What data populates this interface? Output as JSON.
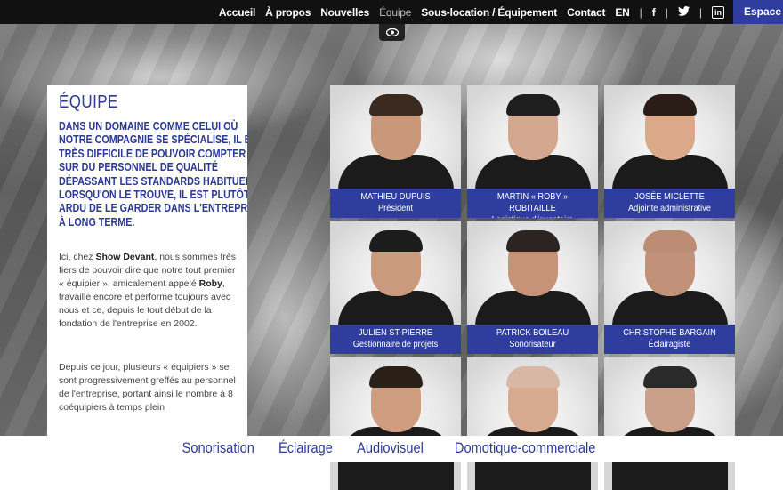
{
  "nav": {
    "links": [
      "Accueil",
      "À propos",
      "Nouvelles",
      "Équipe",
      "Sous-location / Équipement",
      "Contact",
      "EN"
    ],
    "active": "Équipe",
    "separator": "|",
    "social": [
      "facebook-icon",
      "twitter-icon",
      "linkedin-icon"
    ],
    "social_glyphs": [
      "f",
      "t",
      "in"
    ],
    "espace_label": "Espace Cl"
  },
  "panel": {
    "title": "ÉQUIPE",
    "intro": "Dans un domaine comme celui où notre compagnie se spécialise, il est très difficile de pouvoir compter sur du personnel de qualité dépassant les standards habituels. Lorsqu'on le trouve, il est plutôt ardu de le garder dans l'entreprise à long terme.",
    "p1_a": "Ici, chez ",
    "p1_b": "Show Devant",
    "p1_c": ", nous sommes très fiers de pouvoir dire que notre tout premier « équipier », amicalement appelé ",
    "p1_d": "Roby",
    "p1_e": ", travaille encore et performe toujours avec nous et ce, depuis le tout début de la fondation de l'entreprise en 2002.",
    "p2": "Depuis ce jour, plusieurs « équipiers » se sont progressivement greffés au personnel de l'entreprise, portant ainsi le nombre à 8 coéquipiers à temps plein"
  },
  "team": [
    {
      "name": "Mathieu Dupuis",
      "role": "Président",
      "hair": "#3a2a20",
      "skin": "#c9987a"
    },
    {
      "name": "Martin « Roby » Robitaille",
      "role": "Logistique d'inventaire",
      "hair": "#1e1e1e",
      "skin": "#d3a88f"
    },
    {
      "name": "Josée Miclette",
      "role": "Adjointe administrative",
      "hair": "#2a1c16",
      "skin": "#d9a98a"
    },
    {
      "name": "Julien St-Pierre",
      "role": "Gestionnaire de projets",
      "hair": "#1c1c1c",
      "skin": "#c99a7c"
    },
    {
      "name": "Patrick Boileau",
      "role": "Sonorisateur",
      "hair": "#2b2420",
      "skin": "#c69378"
    },
    {
      "name": "Christophe Bargain",
      "role": "Éclairagiste",
      "hair": "#bc8c74",
      "skin": "#c2917a"
    },
    {
      "name": "",
      "role": "",
      "hair": "#2a2018",
      "skin": "#cf9e80"
    },
    {
      "name": "",
      "role": "",
      "hair": "#d8b8a4",
      "skin": "#d7a98f"
    },
    {
      "name": "",
      "role": "",
      "hair": "#2a2a2a",
      "skin": "#caa08a"
    }
  ],
  "bottom": [
    "Sonorisation",
    "Éclairage",
    "Audiovisuel",
    "Domotique-commerciale"
  ],
  "colors": {
    "accent": "#2f3e9e",
    "nav_bg": "#111111"
  }
}
